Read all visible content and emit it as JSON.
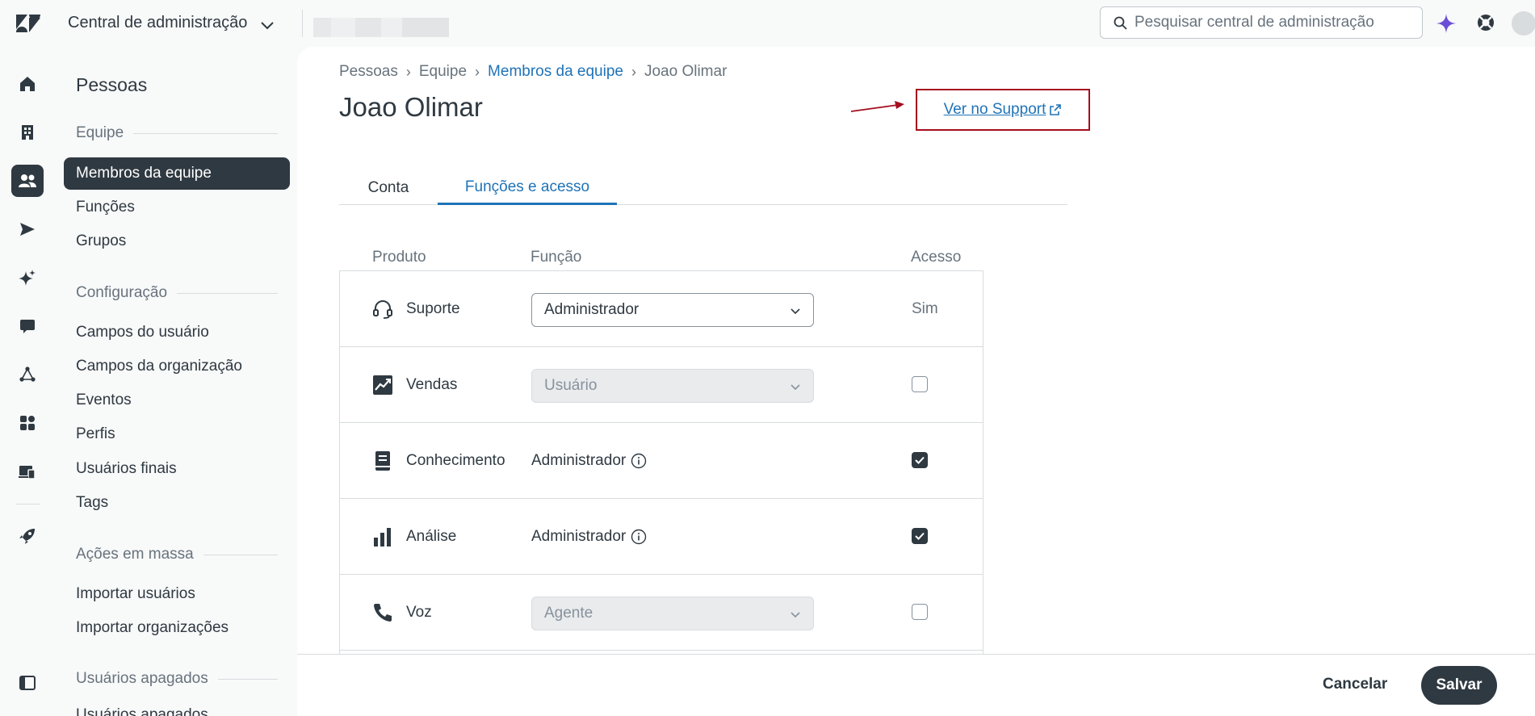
{
  "topbar": {
    "app_title": "Central de administração",
    "search_placeholder": "Pesquisar central de administração"
  },
  "sidebar": {
    "title": "Pessoas",
    "sections": [
      {
        "label": "Equipe",
        "items": [
          "Membros da equipe",
          "Funções",
          "Grupos"
        ]
      },
      {
        "label": "Configuração",
        "items": [
          "Campos do usuário",
          "Campos da organização",
          "Eventos",
          "Perfis",
          "Usuários finais",
          "Tags"
        ]
      },
      {
        "label": "Ações em massa",
        "items": [
          "Importar usuários",
          "Importar organizações"
        ]
      },
      {
        "label": "Usuários apagados",
        "items": [
          "Usuários apagados"
        ]
      }
    ],
    "active_item": "Membros da equipe"
  },
  "rail": {
    "icons": [
      "home-icon",
      "building-icon",
      "people-icon",
      "send-icon",
      "sparkle-icon",
      "chat-icon",
      "network-icon",
      "apps-icon",
      "device-icon",
      "rocket-icon",
      "sidebar-toggle-icon"
    ],
    "active_icon": "people-icon"
  },
  "breadcrumb": [
    "Pessoas",
    "Equipe",
    "Membros da equipe",
    "Joao Olimar"
  ],
  "page": {
    "title": "Joao Olimar",
    "support_link": "Ver no Support"
  },
  "tabs": [
    {
      "label": "Conta",
      "active": false
    },
    {
      "label": "Funções e acesso",
      "active": true
    }
  ],
  "table": {
    "headers": [
      "Produto",
      "Função",
      "Acesso"
    ],
    "rows": [
      {
        "product": "Suporte",
        "icon": "headset-icon",
        "role_type": "select",
        "role": "Administrador",
        "access_type": "text",
        "access": "Sim"
      },
      {
        "product": "Vendas",
        "icon": "trend-chart-icon",
        "role_type": "select-disabled",
        "role": "Usuário",
        "access_type": "checkbox",
        "checked": false
      },
      {
        "product": "Conhecimento",
        "icon": "book-icon",
        "role_type": "text",
        "role": "Administrador",
        "access_type": "checkbox",
        "checked": true
      },
      {
        "product": "Análise",
        "icon": "bar-chart-icon",
        "role_type": "text",
        "role": "Administrador",
        "access_type": "checkbox",
        "checked": true
      },
      {
        "product": "Voz",
        "icon": "phone-icon",
        "role_type": "select-disabled",
        "role": "Agente",
        "access_type": "checkbox",
        "checked": false
      }
    ]
  },
  "footer": {
    "cancel_label": "Cancelar",
    "save_label": "Salvar"
  },
  "colors": {
    "accent": "#1f73b7",
    "dark": "#2f3941",
    "annotation": "#a50e1e",
    "ai_sparkle": "#6a4fd6"
  }
}
